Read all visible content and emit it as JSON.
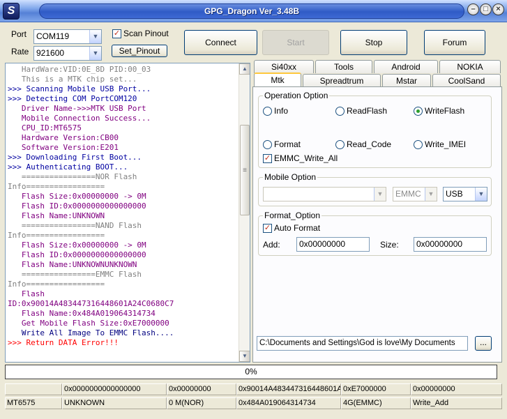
{
  "window": {
    "title": "GPG_Dragon Ver_3.48B",
    "icon_letter": "S"
  },
  "controls": {
    "port_label": "Port",
    "port_value": "COM119",
    "rate_label": "Rate",
    "rate_value": "921600",
    "scan_pinout_label": "Scan Pinout",
    "scan_pinout_checked": true,
    "set_pinout_label": "Set_Pinout",
    "connect_label": "Connect",
    "start_label": "Start",
    "stop_label": "Stop",
    "forum_label": "Forum"
  },
  "log": [
    {
      "text": "   HardWare:VID:0E_8D PID:00_03",
      "color": "gray"
    },
    {
      "text": "   This is a MTK chip set...",
      "color": "gray"
    },
    {
      "text": ">>> Scanning Mobile USB Port...",
      "color": "navy"
    },
    {
      "text": ">>> Detecting COM PortCOM120",
      "color": "navy"
    },
    {
      "text": "   Driver Name->>>MTK USB Port",
      "color": "purple"
    },
    {
      "text": "   Mobile Connection Success...",
      "color": "purple"
    },
    {
      "text": "   CPU_ID:MT6575",
      "color": "purple"
    },
    {
      "text": "   Hardware Version:CB00",
      "color": "purple"
    },
    {
      "text": "   Software Version:E201",
      "color": "purple"
    },
    {
      "text": ">>> Downloading First Boot...",
      "color": "navy"
    },
    {
      "text": ">>> Authenticating BOOT...",
      "color": "navy"
    },
    {
      "text": "   ================NOR Flash",
      "color": "gray"
    },
    {
      "text": "Info=================",
      "color": "gray"
    },
    {
      "text": "   Flash Size:0x00000000 -> 0M",
      "color": "purple"
    },
    {
      "text": "   Flash ID:0x0000000000000000",
      "color": "purple"
    },
    {
      "text": "   Flash Name:UNKNOWN",
      "color": "purple"
    },
    {
      "text": "   ================NAND Flash",
      "color": "gray"
    },
    {
      "text": "Info=================",
      "color": "gray"
    },
    {
      "text": "   Flash Size:0x00000000 -> 0M",
      "color": "purple"
    },
    {
      "text": "   Flash ID:0x0000000000000000",
      "color": "purple"
    },
    {
      "text": "   Flash Name:UNKNOWNUNKNOWN",
      "color": "purple"
    },
    {
      "text": "   ================EMMC Flash",
      "color": "gray"
    },
    {
      "text": "Info=================",
      "color": "gray"
    },
    {
      "text": "   Flash",
      "color": "purple"
    },
    {
      "text": "ID:0x90014A483447316448601A24C0680C7",
      "color": "purple"
    },
    {
      "text": "   Flash Name:0x484A019064314734",
      "color": "purple"
    },
    {
      "text": "   Get Mobile Flash Size:0xE7000000",
      "color": "purple"
    },
    {
      "text": "   Write All Image To EMMC Flash....",
      "color": "blue"
    },
    {
      "text": ">>> Return DATA Error!!!",
      "color": "red"
    }
  ],
  "tabs_row1": [
    "Si40xx",
    "Tools",
    "Android",
    "NOKIA"
  ],
  "tabs_row2": [
    "Mtk",
    "Spreadtrum",
    "Mstar",
    "CoolSand"
  ],
  "active_tab": "Mtk",
  "operation": {
    "title": "Operation Option",
    "options": [
      "Info",
      "ReadFlash",
      "WriteFlash",
      "Format",
      "Read_Code",
      "Write_IMEI"
    ],
    "selected": "WriteFlash",
    "emmc_write_all_label": "EMMC_Write_All",
    "emmc_write_all_checked": true
  },
  "mobile": {
    "title": "Mobile Option",
    "model_value": "",
    "storage_value": "EMMC",
    "connection_value": "USB"
  },
  "format": {
    "title": "Format_Option",
    "auto_format_label": "Auto Format",
    "auto_format_checked": true,
    "add_label": "Add:",
    "add_value": "0x00000000",
    "size_label": "Size:",
    "size_value": "0x00000000"
  },
  "file_path": {
    "value": "C:\\Documents and Settings\\God is love\\My Documents",
    "browse_label": "..."
  },
  "progress": {
    "percent": 0,
    "label": "0%"
  },
  "status_row1": [
    "",
    "0x0000000000000000",
    "0x00000000",
    "0x90014A483447316448601A",
    "0xE7000000",
    "0x00000000"
  ],
  "status_row2": [
    "MT6575",
    "UNKNOWN",
    "0 M(NOR)",
    "0x484A019064314734",
    "4G(EMMC)",
    "Write_Add"
  ],
  "colors": {
    "title_blue": "#2f5bc6",
    "log_gray": "#808080",
    "log_purple": "#800080",
    "log_navy": "#0000a0",
    "log_red": "#ff0000",
    "tab_highlight": "#ffc83c"
  }
}
